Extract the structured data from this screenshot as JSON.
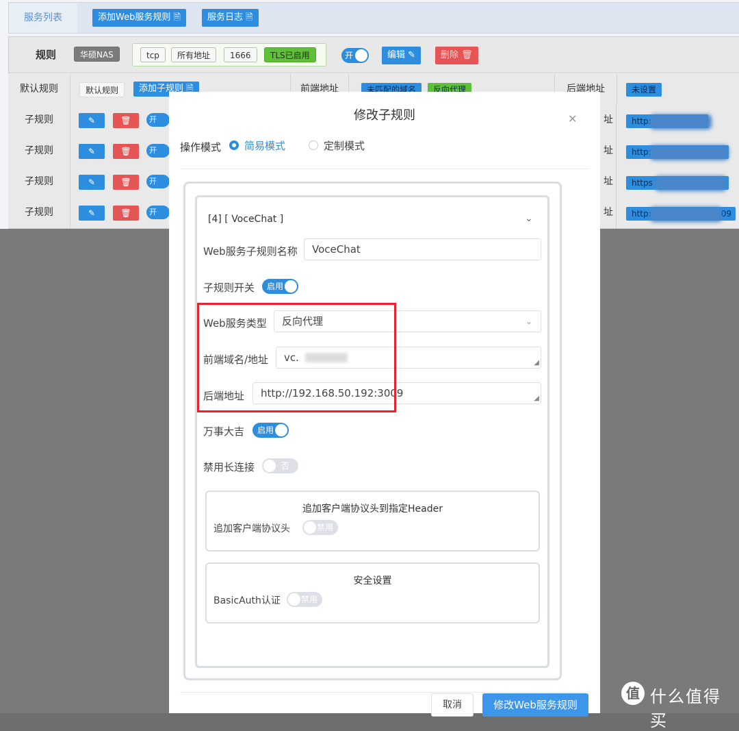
{
  "tabs": {
    "service_list": "服务列表",
    "add_rule": "添加Web服务规则",
    "service_log": "服务日志"
  },
  "rule_bar": {
    "label": "规则",
    "name_tag": "华硕NAS",
    "proto": "tcp",
    "address": "所有地址",
    "port": "1666",
    "tls": "TLS已启用",
    "switch_label": "开",
    "edit": "编辑",
    "delete": "删除"
  },
  "table": {
    "default_row": {
      "col1": "默认规则",
      "name": "默认规则",
      "add_child": "添加子规则",
      "frontend_label": "前端地址",
      "unmatched": "未匹配的域名",
      "reverse": "反向代理",
      "backend_label": "后端地址",
      "backend_value": "未设置"
    },
    "child_label": "子规则",
    "switch_label": "开",
    "backend_col_prefix": "址",
    "rows": [
      {
        "label": "子规则",
        "backend": "http:"
      },
      {
        "label": "子规则",
        "backend": "http:"
      },
      {
        "label": "子规则",
        "backend": "https"
      },
      {
        "label": "子规则",
        "backend": "http:",
        "suffix": "09"
      }
    ]
  },
  "modal": {
    "title": "修改子规则",
    "mode_label": "操作模式",
    "mode_simple": "简易模式",
    "mode_custom": "定制模式",
    "item_title": "[4] [ VoceChat ]",
    "name_label": "Web服务子规则名称",
    "name_value": "VoceChat",
    "switch_label": "子规则开关",
    "switch_value": "启用",
    "type_label": "Web服务类型",
    "type_value": "反向代理",
    "frontend_label": "前端域名/地址",
    "frontend_value": "vc.",
    "backend_label": "后端地址",
    "backend_value": "http://192.168.50.192:3009",
    "lucky_label": "万事大吉",
    "lucky_value": "启用",
    "longconn_label": "禁用长连接",
    "longconn_value": "否",
    "header_card_title": "追加客户端协议头到指定Header",
    "header_label": "追加客户端协议头",
    "header_value": "禁用",
    "security_card_title": "安全设置",
    "basicauth_label": "BasicAuth认证",
    "basicauth_value": "禁用",
    "cancel": "取消",
    "submit": "修改Web服务规则"
  },
  "watermark": {
    "logo": "值",
    "text": "什么值得买"
  }
}
